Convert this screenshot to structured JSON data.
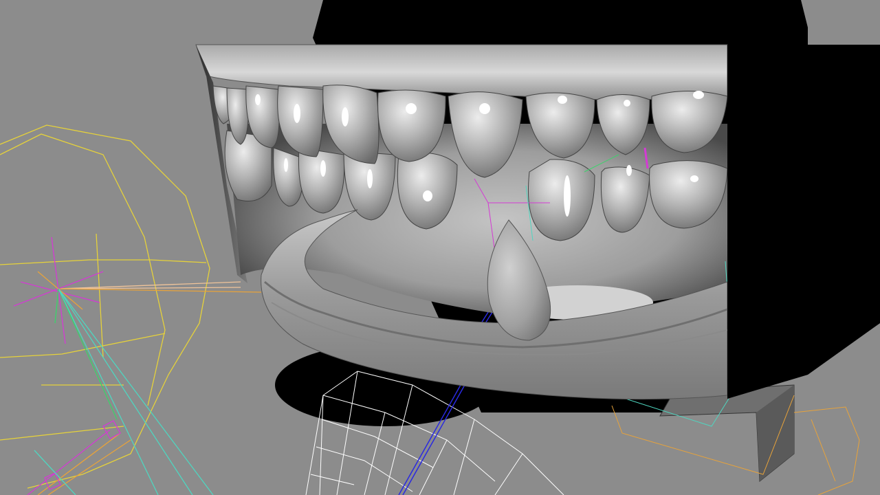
{
  "viewport": {
    "background": "#8c8c8c",
    "wire_colors": {
      "yellow": "#e6d23a",
      "orange": "#e8a33a",
      "magenta": "#d43ad4",
      "green": "#3ad46a",
      "cyan": "#4fd6c0",
      "blue": "#2a2ae0",
      "white": "#ffffff",
      "peach": "#f0c49a"
    }
  }
}
